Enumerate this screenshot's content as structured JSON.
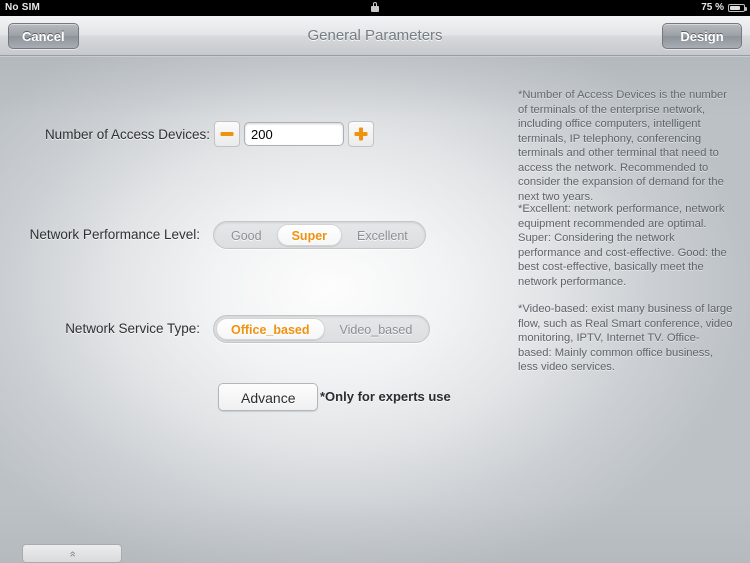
{
  "status_bar": {
    "carrier": "No SIM",
    "rotation_lock_icon": "lock-icon",
    "battery_percent": "75 %",
    "battery_icon": "battery-icon"
  },
  "nav_bar": {
    "cancel_label": "Cancel",
    "title": "General Parameters",
    "design_label": "Design"
  },
  "form": {
    "access_devices": {
      "label": "Number of Access Devices:",
      "decrement_icon": "minus-icon",
      "increment_icon": "plus-icon",
      "value": "200",
      "placeholder": "200"
    },
    "performance_level": {
      "label": "Network Performance Level:",
      "options": [
        "Good",
        "Super",
        "Excellent"
      ],
      "selected": "Super"
    },
    "service_type": {
      "label": "Network Service Type:",
      "options": [
        "Office_based",
        "Video_based"
      ],
      "selected": "Office_based"
    },
    "advance": {
      "button_label": "Advance",
      "note": "*Only for experts use"
    }
  },
  "help": {
    "paragraph_1": "*Number of Access Devices is the number of terminals of the enterprise network, including office computers, intelligent terminals, IP telephony, conferencing terminals and other terminal that need to access the network. Recommended to consider the expansion of demand for the next two years.",
    "paragraph_2": "*Excellent: network performance, network equipment recommended are optimal. Super: Considering the network performance and cost-effective. Good: the best cost-effective, basically meet the network performance.",
    "paragraph_3": "*Video-based: exist many business of large flow, such as Real Smart conference, video monitoring, IPTV, Internet TV. Office-based: Mainly common office business, less video services."
  },
  "bottom_bar": {
    "expand_icon": "chevron-double-up-icon",
    "expand_glyph": "«"
  },
  "colors": {
    "accent_orange": "#f0920f",
    "nav_title": "#757d86",
    "help_text": "#5f646a"
  }
}
